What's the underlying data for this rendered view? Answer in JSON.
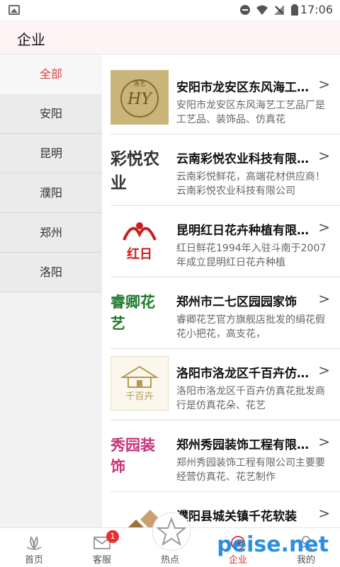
{
  "status": {
    "time": "17:06"
  },
  "header": {
    "title": "企业"
  },
  "sidebar": {
    "items": [
      "全部",
      "安阳",
      "昆明",
      "濮阳",
      "郑州",
      "洛阳"
    ],
    "active_index": 0
  },
  "companies": [
    {
      "name": "安阳市龙安区东风海工艺品厂",
      "desc": "安阳市龙安区东风海艺工艺品厂是工艺品、装饰品、仿真花",
      "logo": "洛艺 HY",
      "logo_color": "#a48a43"
    },
    {
      "name": "云南彩悦农业科技有限公司",
      "desc": "云南彩悦鲜花，高端花材供应商！ 云南彩悦农业科技有限公司",
      "logo": "彩悦农业",
      "logo_color": "#333333"
    },
    {
      "name": "昆明红日花卉种植有限公司",
      "desc": "红日鲜花1994年入驻斗南于2007年成立昆明红日花卉种植",
      "logo": "红日",
      "logo_color": "#c81e1e"
    },
    {
      "name": "郑州市二七区园园家饰",
      "desc": "睿卿花艺官方旗舰店批发的绢花假花小把花，高支花，",
      "logo": "睿卿花艺",
      "logo_color": "#1d7a2a"
    },
    {
      "name": "洛阳市洛龙区千百卉仿真花",
      "desc": "洛阳市洛龙区千百卉仿真花批发商行是仿真花朵、花艺",
      "logo": "千百卉",
      "logo_color": "#b39a55"
    },
    {
      "name": "郑州秀园装饰工程有限公司",
      "desc": "郑州秀园装饰工程有限公司主要要经营仿真花、花艺制作",
      "logo": "秀园装饰",
      "logo_color": "#c8327a"
    },
    {
      "name": "濮阳县城关镇千花软装",
      "desc": "",
      "logo": "",
      "logo_color": "#a0713a"
    }
  ],
  "chevron": ">",
  "bottom_nav": {
    "tabs": [
      {
        "label": "首页",
        "icon": "lotus-icon"
      },
      {
        "label": "客服",
        "icon": "mail-icon",
        "badge": "1"
      },
      {
        "label": "热点",
        "icon": "star-icon"
      },
      {
        "label": "企业",
        "icon": "company-icon"
      },
      {
        "label": "我的",
        "icon": "user-icon"
      }
    ],
    "active_index": 3
  },
  "watermark": "peise.net",
  "colors": {
    "accent": "#e04040",
    "badge": "#e73030",
    "header_bg": "#fdf4f5"
  }
}
